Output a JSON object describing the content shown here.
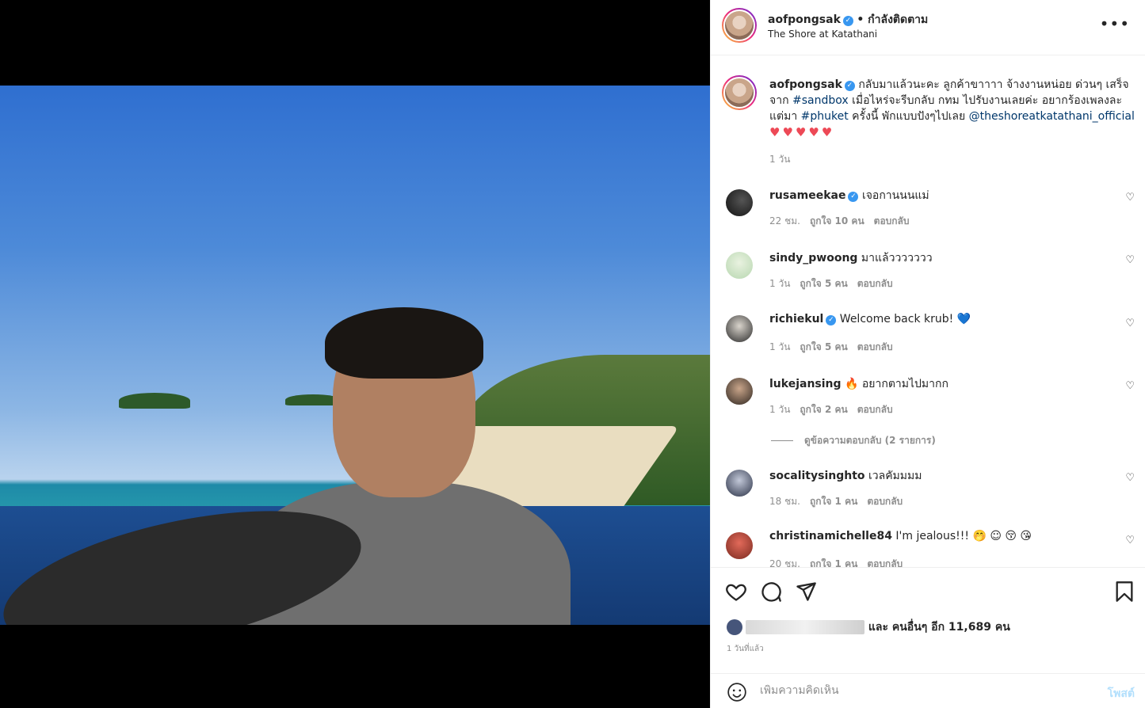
{
  "header": {
    "username": "aofpongsak",
    "follow_state": "• กำลังติดตาม",
    "location": "The Shore at Katathani",
    "more": "•••"
  },
  "caption": {
    "username": "aofpongsak",
    "text_1": " กลับมาแล้วนะคะ ลูกค้าขาาาา จ้างงานหน่อย ด่วนๆ เสร็จจาก ",
    "tag_sandbox": "#sandbox",
    "text_2": " เมื่อไหร่จะรีบกลับ กทม ไปรับงานเลยค่ะ อยากร้องเพลงละแต่มา ",
    "tag_phuket": "#phuket",
    "text_3": " ครั้งนี้ พักแบบปังๆไปเลย ",
    "mention": "@theshoreatkatathani_official",
    "hearts": "♥♥♥♥♥",
    "time": "1 วัน"
  },
  "comments": [
    {
      "user": "rusameekae",
      "verified": true,
      "text": "เจอกานนนแม่",
      "time": "22 ชม.",
      "likes": "ถูกใจ 10 คน",
      "reply": "ตอบกลับ"
    },
    {
      "user": "sindy_pwoong",
      "verified": false,
      "text": "มาแล้ววววววว",
      "time": "1 วัน",
      "likes": "ถูกใจ 5 คน",
      "reply": "ตอบกลับ"
    },
    {
      "user": "richiekul",
      "verified": true,
      "text": "Welcome back krub! 💙",
      "time": "1 วัน",
      "likes": "ถูกใจ 5 คน",
      "reply": "ตอบกลับ"
    },
    {
      "user": "lukejansing",
      "verified": false,
      "text": "🔥 อยากตามไปมากก",
      "time": "1 วัน",
      "likes": "ถูกใจ 2 คน",
      "reply": "ตอบกลับ"
    },
    {
      "user": "socalitysinghto",
      "verified": false,
      "text": "เวลคัมมมม",
      "time": "18 ชม.",
      "likes": "ถูกใจ 1 คน",
      "reply": "ตอบกลับ"
    },
    {
      "user": "christinamichelle84",
      "verified": false,
      "text": "I'm jealous!!! 🤭 ☺ 😚 😘",
      "time": "20 ชม.",
      "likes": "ถูกใจ 1 คน",
      "reply": "ตอบกลับ"
    }
  ],
  "view_replies": "ดูข้อความตอบกลับ (2 รายการ)",
  "likes_line": {
    "others": " และ คนอื่นๆ อีก 11,689 คน"
  },
  "posted_ago": "1 วันที่แล้ว",
  "add_comment": {
    "placeholder": "เพิ่มความคิดเห็น",
    "post_label": "โพสต์"
  },
  "colors": {
    "verified": "#3897f0",
    "hashtag": "#00376b",
    "post_disabled": "#b2dffc"
  }
}
